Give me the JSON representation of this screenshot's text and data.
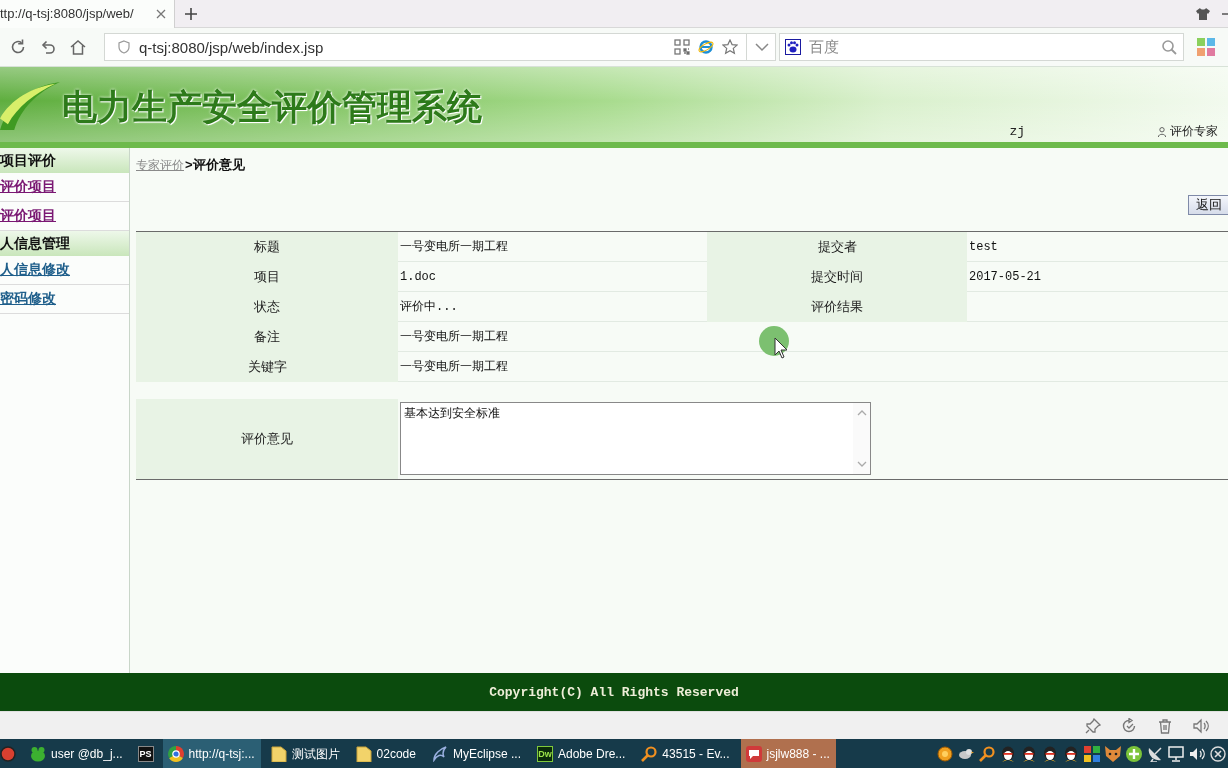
{
  "browser": {
    "tabs": [
      {
        "title": "ttp://q-tsj:8080/jsp/web/",
        "selected": true
      }
    ],
    "address": "q-tsj:8080/jsp/web/index.jsp",
    "search": {
      "placeholder": "百度"
    }
  },
  "header": {
    "title": "电力生产安全评价管理系统",
    "username": "zj",
    "role": "评价专家"
  },
  "sidebar": {
    "sections": [
      {
        "title": "项目评价",
        "items": [
          {
            "label": "评价项目",
            "visited": true
          },
          {
            "label": "评价项目",
            "visited": true
          }
        ]
      },
      {
        "title": "人信息管理",
        "items": [
          {
            "label": "人信息修改",
            "visited": false
          },
          {
            "label": "密码修改",
            "visited": false
          }
        ]
      }
    ]
  },
  "breadcrumb": {
    "link": "专家评价",
    "current": ">评价意见"
  },
  "back_button": "返回",
  "details": {
    "rows": [
      {
        "pairs": [
          {
            "label": "标题",
            "value": "一号变电所一期工程"
          },
          {
            "label": "提交者",
            "value": "test"
          }
        ]
      },
      {
        "pairs": [
          {
            "label": "项目",
            "value": "1.doc"
          },
          {
            "label": "提交时间",
            "value": "2017-05-21"
          }
        ]
      },
      {
        "pairs": [
          {
            "label": "状态",
            "value": "评价中..."
          },
          {
            "label": "评价结果"
          }
        ]
      },
      {
        "pairs": [
          {
            "label": "备注",
            "value": "一号变电所一期工程"
          }
        ]
      },
      {
        "pairs": [
          {
            "label": "关键字",
            "value": "一号变电所一期工程"
          }
        ]
      }
    ]
  },
  "opinion": {
    "label": "评价意见",
    "value": "基本达到安全标准"
  },
  "footer": "Copyright(C) All Rights Reserved",
  "taskbar": {
    "items": [
      {
        "selected": false,
        "highlighted": false
      },
      {
        "label": "user @db_j...",
        "selected": false,
        "highlighted": false
      },
      {
        "icon_text": "PS",
        "selected": false,
        "highlighted": false
      },
      {
        "label": "http://q-tsj:...",
        "selected": true,
        "highlighted": false
      },
      {
        "label": "测试图片",
        "selected": false,
        "highlighted": false
      },
      {
        "label": "02code",
        "selected": false,
        "highlighted": false
      },
      {
        "label": "MyEclipse ...",
        "selected": false,
        "highlighted": false
      },
      {
        "icon_text": "Dw",
        "label": "Adobe Dre...",
        "selected": false,
        "highlighted": false
      },
      {
        "label": "43515 - Ev...",
        "selected": false,
        "highlighted": false
      },
      {
        "label": "jsjlw888 - ...",
        "selected": false,
        "highlighted": true
      }
    ]
  }
}
